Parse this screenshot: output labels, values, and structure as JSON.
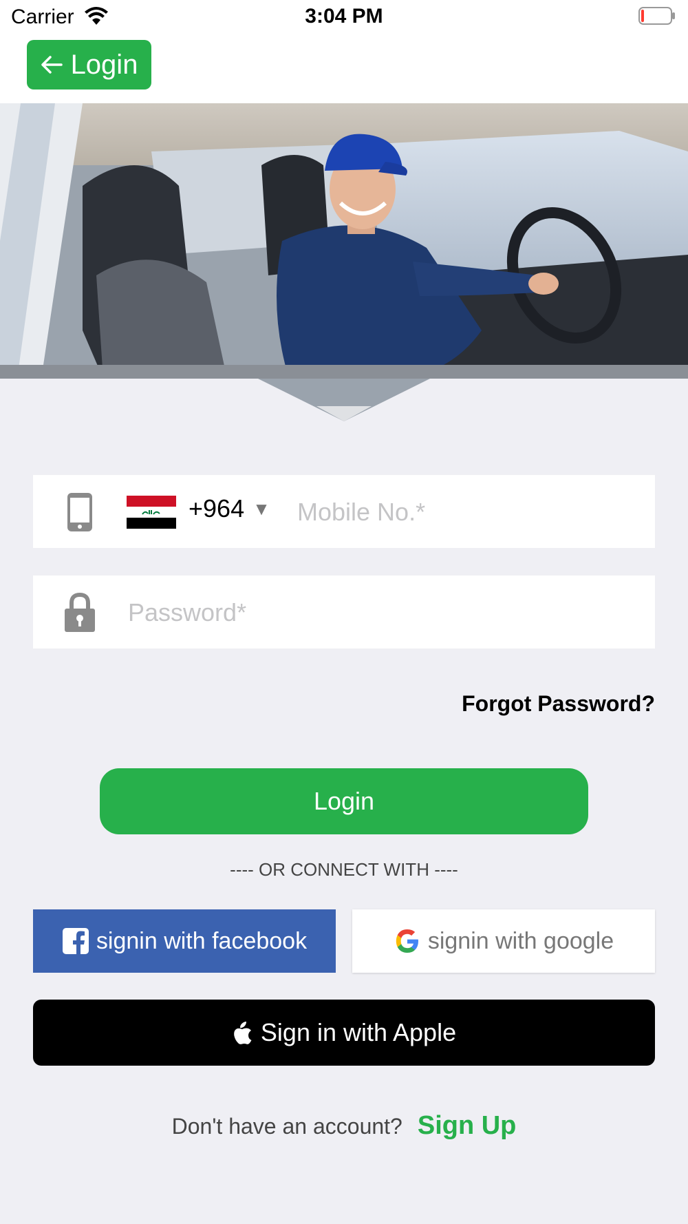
{
  "status_bar": {
    "carrier": "Carrier",
    "time": "3:04 PM",
    "battery_level": 0.1
  },
  "nav": {
    "back_label": "Login",
    "accent_color": "#27b04b"
  },
  "phone": {
    "country_code": "+964",
    "country_flag": "Iraq",
    "placeholder": "Mobile No.*",
    "value": ""
  },
  "password": {
    "placeholder": "Password*",
    "value": ""
  },
  "forgot_password": "Forgot Password?",
  "login_button": "Login",
  "divider_text": "---- OR CONNECT WITH ----",
  "social": {
    "facebook_label": "signin with facebook",
    "facebook_color": "#3b62b0",
    "google_label": "signin with google",
    "apple_label": "Sign in with Apple"
  },
  "signup": {
    "question": "Don't have an account?",
    "link": "Sign Up"
  },
  "icons": {
    "back": "arrow-left-icon",
    "phone": "mobile-phone-icon",
    "lock": "lock-icon",
    "dropdown": "triangle-down-icon",
    "facebook": "facebook-icon",
    "google": "google-icon",
    "apple": "apple-icon"
  }
}
